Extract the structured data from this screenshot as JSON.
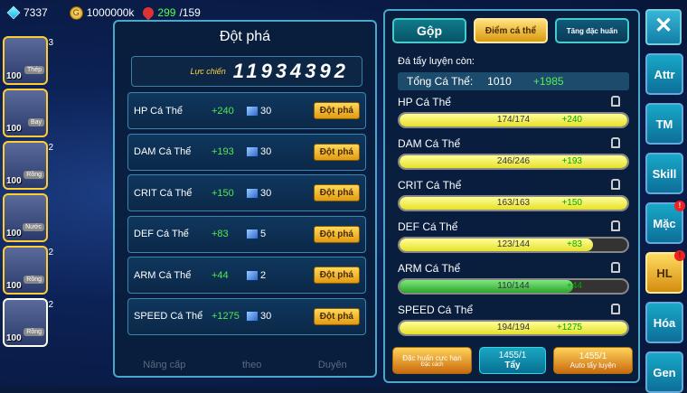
{
  "top": {
    "gems": "7337",
    "gold": "1000000k",
    "hearts": "299",
    "hearts_max": "/159"
  },
  "left": {
    "title": "Đột phá",
    "power_label": "Lực chiến",
    "power": "11934392",
    "rows": [
      {
        "name": "HP Cá Thể",
        "inc": "+240",
        "cost": "30",
        "btn": "Đột phá"
      },
      {
        "name": "DAM Cá Thể",
        "inc": "+193",
        "cost": "30",
        "btn": "Đột phá"
      },
      {
        "name": "CRIT Cá Thể",
        "inc": "+150",
        "cost": "30",
        "btn": "Đột phá"
      },
      {
        "name": "DEF Cá Thể",
        "inc": "+83",
        "cost": "5",
        "btn": "Đột phá"
      },
      {
        "name": "ARM Cá Thể",
        "inc": "+44",
        "cost": "2",
        "btn": "Đột phá"
      },
      {
        "name": "SPEED Cá Thể",
        "inc": "+1275",
        "cost": "30",
        "btn": "Đột phá"
      }
    ],
    "footer": [
      "Nâng cấp",
      "theo",
      "Duyên"
    ]
  },
  "pets": [
    {
      "lv": "100",
      "tag": "Thép",
      "num": "3"
    },
    {
      "lv": "100",
      "tag": "Bay",
      "num": ""
    },
    {
      "lv": "100",
      "tag": "Rồng",
      "num": "2"
    },
    {
      "lv": "100",
      "tag": "Nước",
      "num": ""
    },
    {
      "lv": "100",
      "tag": "Rồng",
      "num": "2"
    },
    {
      "lv": "100",
      "tag": "Rồng",
      "num": "2"
    }
  ],
  "right": {
    "tabs": [
      "Gộp",
      "Điểm cá thể",
      "Tăng đặc huấn"
    ],
    "remain_label": "Đá tẩy luyện còn:",
    "total_label": "Tổng Cá Thể:",
    "total_value": "1010",
    "total_inc": "+1985",
    "stats": [
      {
        "name": "HP Cá Thể",
        "val": "174/174",
        "inc": "+240",
        "fill": 1.0,
        "green": false
      },
      {
        "name": "DAM Cá Thể",
        "val": "246/246",
        "inc": "+193",
        "fill": 1.0,
        "green": false
      },
      {
        "name": "CRIT Cá Thể",
        "val": "163/163",
        "inc": "+150",
        "fill": 1.0,
        "green": false
      },
      {
        "name": "DEF Cá Thể",
        "val": "123/144",
        "inc": "+83",
        "fill": 0.85,
        "green": false
      },
      {
        "name": "ARM Cá Thể",
        "val": "110/144",
        "inc": "+44",
        "fill": 0.76,
        "green": true
      },
      {
        "name": "SPEED Cá Thể",
        "val": "194/194",
        "inc": "+1275",
        "fill": 1.0,
        "green": false
      }
    ],
    "actions": [
      {
        "label": "Đặc huấn cực hạn",
        "sub": "Đặc cách"
      },
      {
        "count": "1455/1",
        "label": "Tẩy"
      },
      {
        "count": "1455/1",
        "label": "Auto tẩy luyện"
      }
    ]
  },
  "nav": {
    "close": "✕",
    "items": [
      "Attr",
      "TM",
      "Skill",
      "Mặc",
      "HL",
      "Hóa",
      "Gen"
    ]
  }
}
